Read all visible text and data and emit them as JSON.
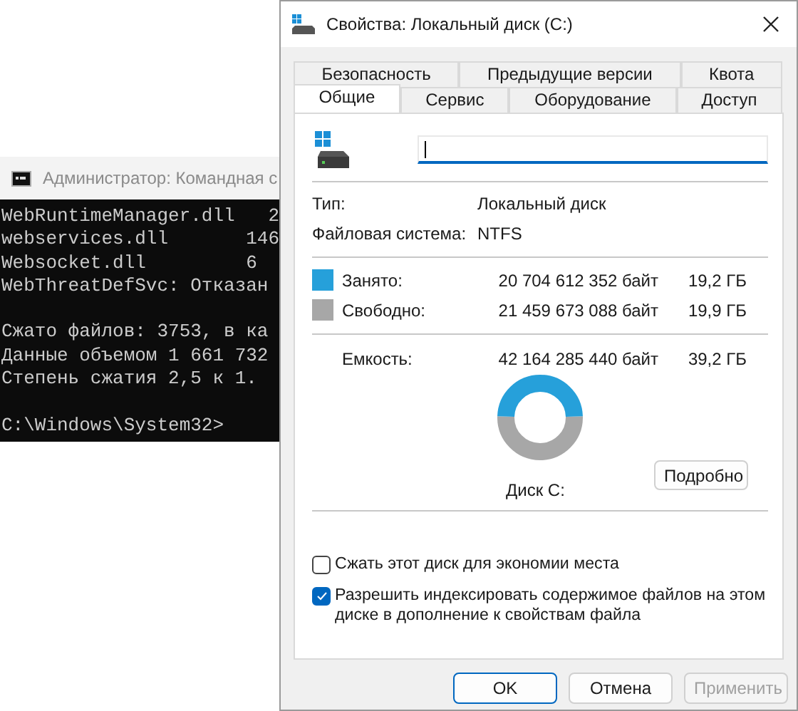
{
  "console": {
    "title": "Администратор: Командная с",
    "blocks": [
      [
        "WebRuntimeManager.dll   2",
        "webservices.dll       146",
        "Websocket.dll         6",
        "WebThreatDefSvc: Отказан"
      ],
      [
        "Сжато файлов: 3753, в ка",
        "Данные объемом 1 661 732",
        "Степень сжатия 2,5 к 1."
      ],
      [
        "C:\\Windows\\System32>"
      ]
    ]
  },
  "dialog": {
    "title": "Свойства: Локальный диск (C:)",
    "tab_rows": [
      [
        {
          "label": "Безопасность",
          "selected": false
        },
        {
          "label": "Предыдущие версии",
          "selected": false
        },
        {
          "label": "Квота",
          "selected": false
        }
      ],
      [
        {
          "label": "Общие",
          "selected": true
        },
        {
          "label": "Сервис",
          "selected": false
        },
        {
          "label": "Оборудование",
          "selected": false
        },
        {
          "label": "Доступ",
          "selected": false
        }
      ]
    ],
    "info": [
      {
        "label": "Тип:",
        "value": "Локальный диск"
      },
      {
        "label": "Файловая система:",
        "value": "NTFS"
      }
    ],
    "usage": [
      {
        "label": "Занято:",
        "bytes": "20 704 612 352 байт",
        "size": "19,2 ГБ",
        "color": "#26a0da"
      },
      {
        "label": "Свободно:",
        "bytes": "21 459 673 088 байт",
        "size": "19,9 ГБ",
        "color": "#a7a7a7"
      }
    ],
    "capacity": {
      "label": "Емкость:",
      "bytes": "42 164 285 440 байт",
      "size": "39,2 ГБ"
    },
    "disk_label": "Диск C:",
    "details_button": "Подробно",
    "options": [
      {
        "label": "Сжать этот диск для экономии места",
        "checked": false
      },
      {
        "label": "Разрешить индексировать содержимое файлов на этом диске в дополнение к свойствам файла",
        "checked": true
      }
    ],
    "buttons": [
      {
        "label": "OK",
        "default": true,
        "disabled": false
      },
      {
        "label": "Отмена",
        "default": false,
        "disabled": false
      },
      {
        "label": "Применить",
        "default": false,
        "disabled": true
      }
    ]
  }
}
